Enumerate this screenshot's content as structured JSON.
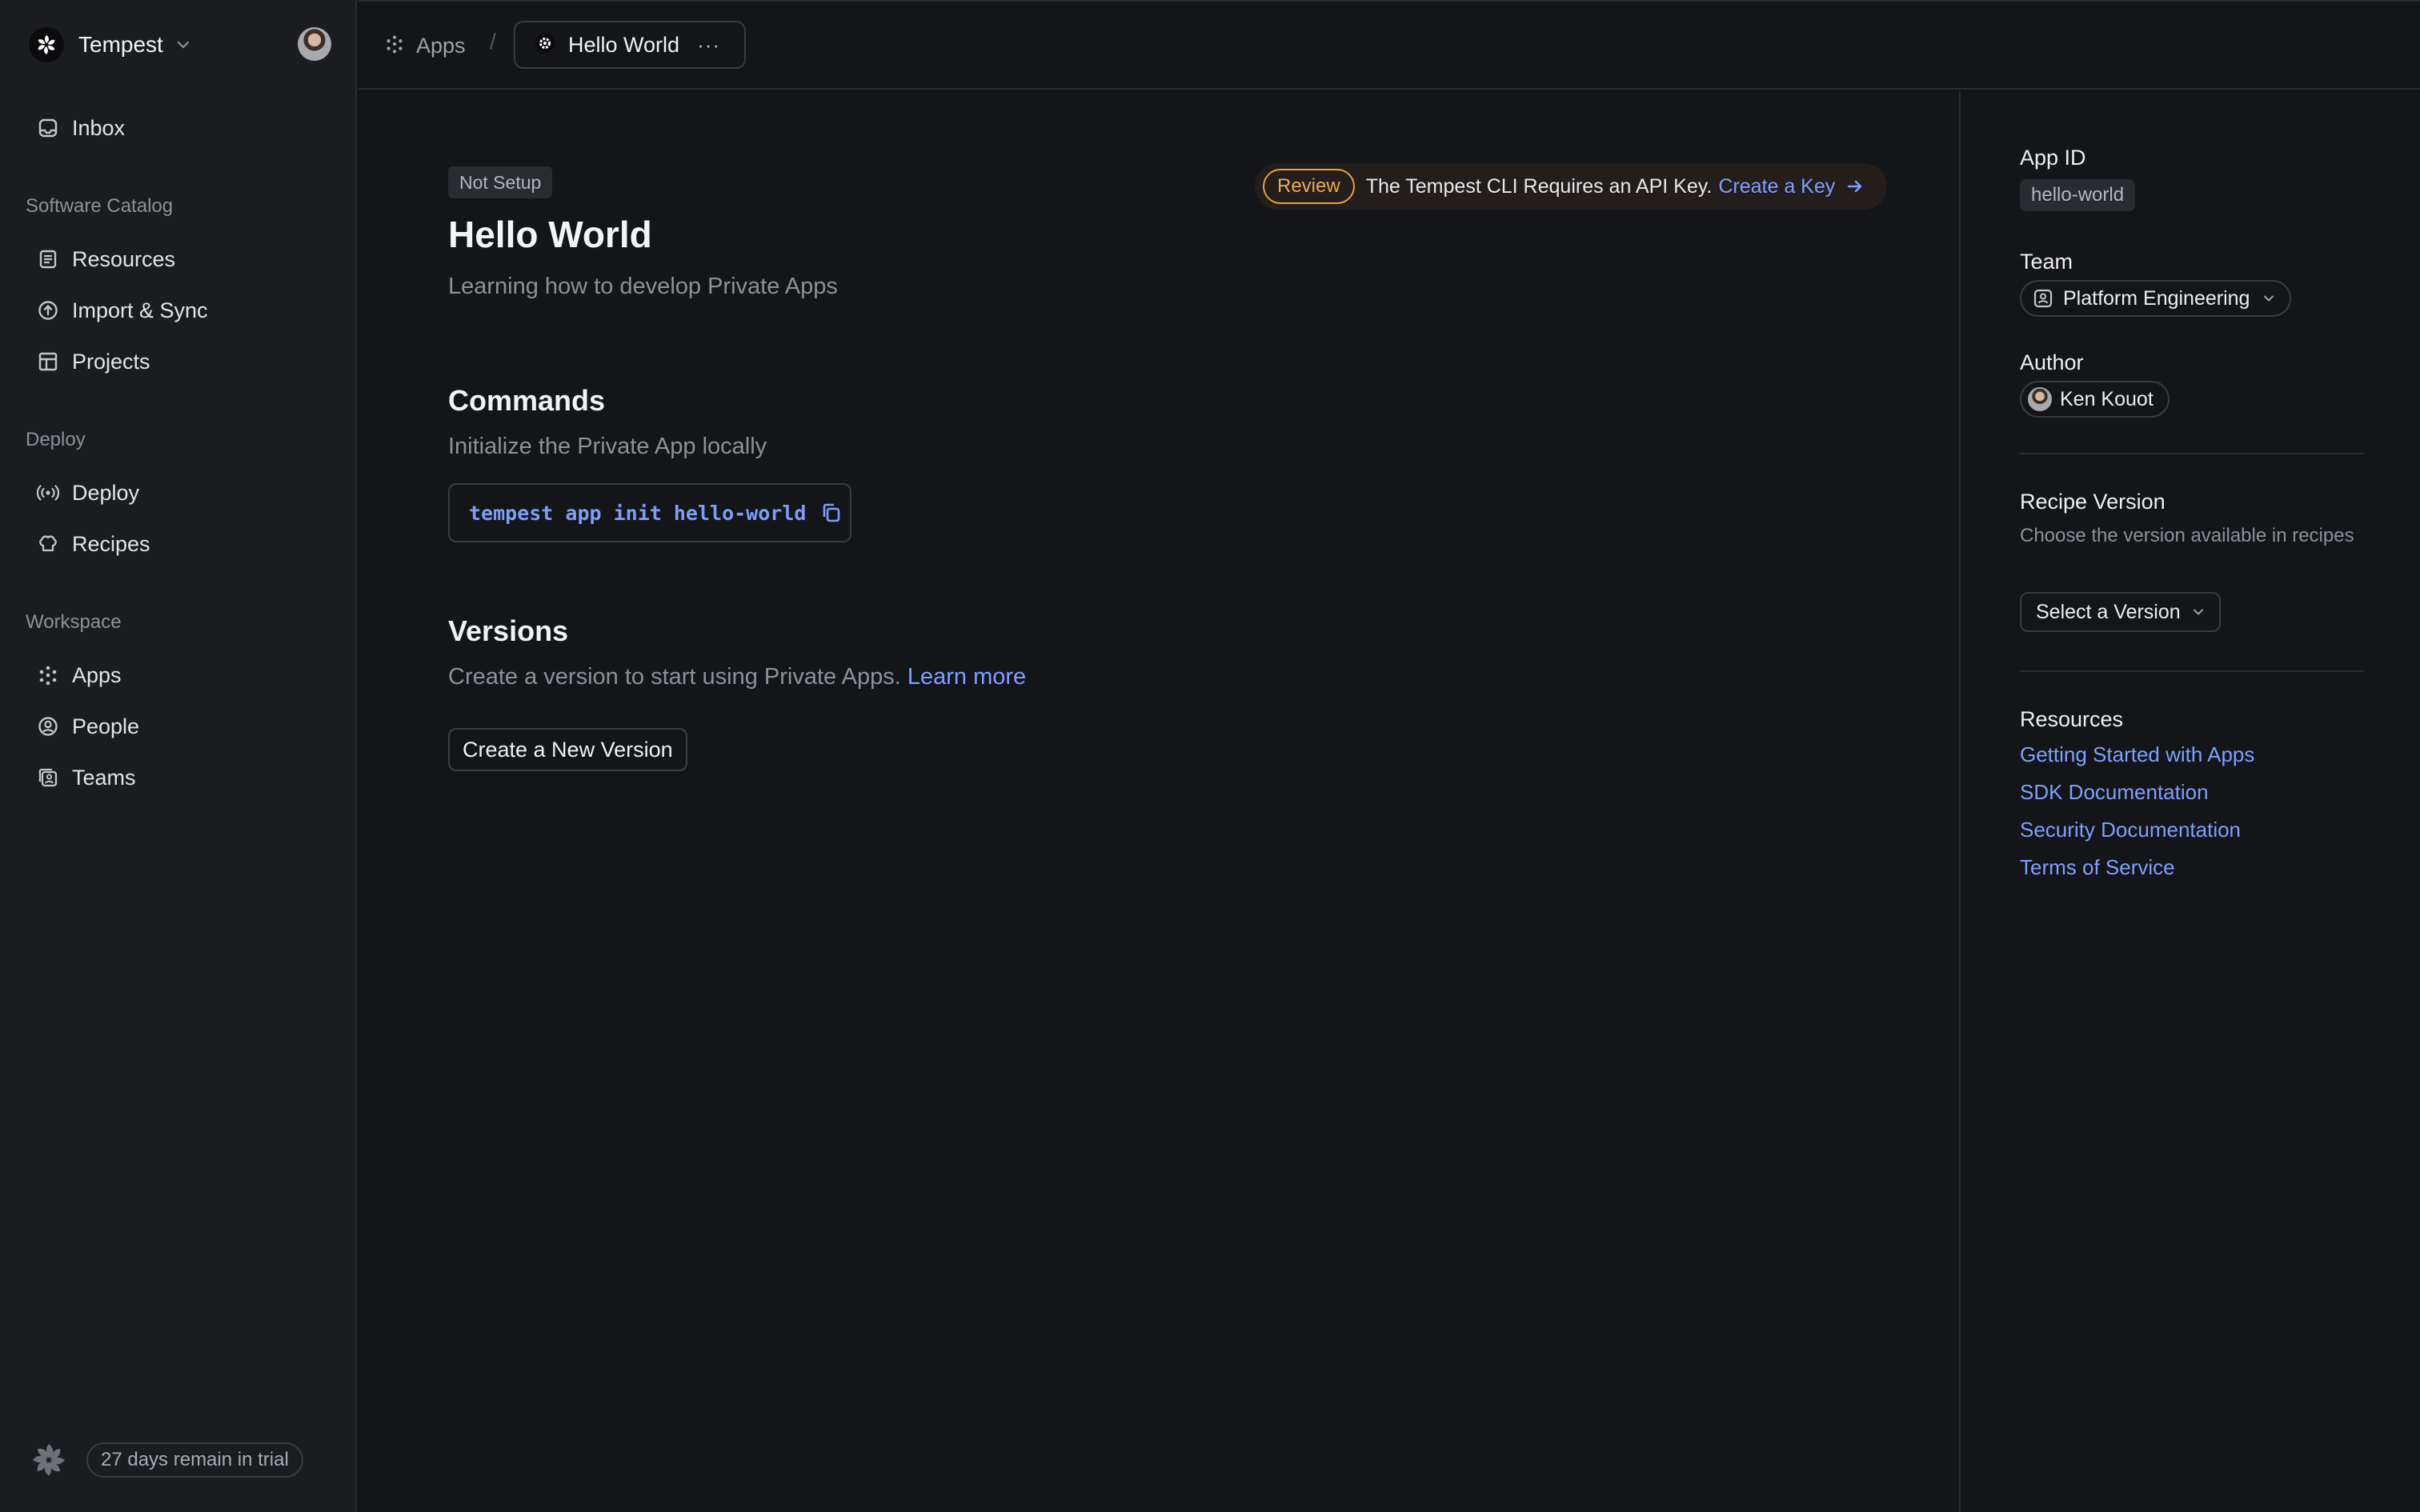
{
  "workspace": {
    "name": "Tempest"
  },
  "sidebar": {
    "inbox": {
      "label": "Inbox",
      "icon": "inbox-icon"
    },
    "sections": [
      {
        "title": "Software Catalog",
        "items": [
          {
            "label": "Resources",
            "icon": "document-icon"
          },
          {
            "label": "Import & Sync",
            "icon": "upload-circle-icon"
          },
          {
            "label": "Projects",
            "icon": "layout-icon"
          }
        ]
      },
      {
        "title": "Deploy",
        "items": [
          {
            "label": "Deploy",
            "icon": "broadcast-icon"
          },
          {
            "label": "Recipes",
            "icon": "chef-hat-icon"
          }
        ]
      },
      {
        "title": "Workspace",
        "items": [
          {
            "label": "Apps",
            "icon": "apps-dots-icon"
          },
          {
            "label": "People",
            "icon": "user-circle-icon"
          },
          {
            "label": "Teams",
            "icon": "team-icon"
          }
        ]
      }
    ],
    "trial_text": "27 days remain in trial"
  },
  "breadcrumb": {
    "parent": "Apps",
    "separator": "/",
    "current": "Hello World",
    "more": "···"
  },
  "app": {
    "status": "Not Setup",
    "title": "Hello World",
    "subtitle": "Learning how to develop Private Apps"
  },
  "banner": {
    "badge": "Review",
    "text": "The Tempest CLI Requires an API Key.",
    "link": "Create a Key"
  },
  "commands": {
    "title": "Commands",
    "description": "Initialize the Private App locally",
    "command": "tempest app init hello-world"
  },
  "versions": {
    "title": "Versions",
    "description": "Create a version to start using Private Apps.",
    "link": "Learn more",
    "button": "Create a New Version"
  },
  "details": {
    "app_id_label": "App ID",
    "app_id": "hello-world",
    "team_label": "Team",
    "team": "Platform Engineering",
    "author_label": "Author",
    "author": "Ken Kouot",
    "recipe_label": "Recipe Version",
    "recipe_desc": "Choose the version available in recipes",
    "recipe_select": "Select a Version",
    "resources_label": "Resources",
    "resources": [
      "Getting Started with Apps",
      "SDK Documentation",
      "Security Documentation",
      "Terms of Service"
    ]
  },
  "colors": {
    "background": "#141519",
    "sidebar": "#1b1c20",
    "accent_link": "#7ca0ff",
    "review": "#f0ab45",
    "code": "#7c9ef8"
  }
}
